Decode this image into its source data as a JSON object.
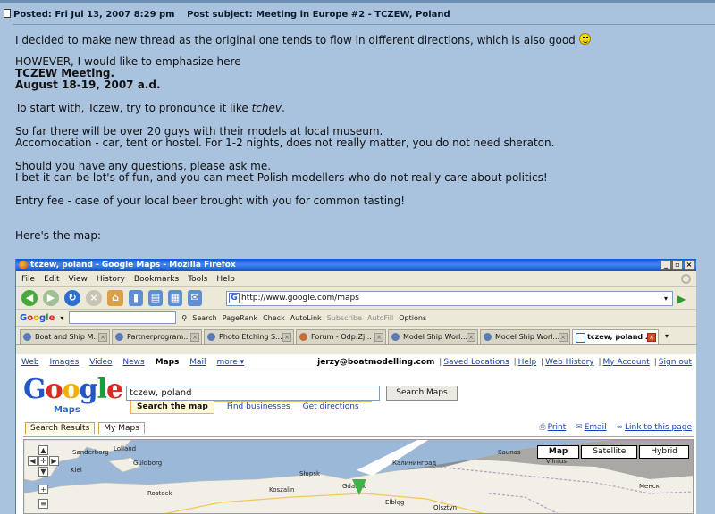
{
  "post": {
    "posted_label": "Posted:",
    "posted_date": "Fri Jul 13, 2007 8:29 pm",
    "subject_label": "Post subject:",
    "subject": "Meeting in Europe #2 - TCZEW, Poland",
    "line1": "I decided to make new thread as the original one tends to flow in different directions, which is also good",
    "line2": "HOWEVER, I would like to emphasize here",
    "line3": "TCZEW Meeting.",
    "line4": "August 18-19, 2007 a.d.",
    "line5a": "To start with, Tczew, try to pronounce it like ",
    "line5b": "tchev",
    "line5c": ".",
    "line6": "So far there will be over 20 guys with their models at local museum.",
    "line7": "Accomodation - car, tent or hostel. For 1-2 nights, does not really matter, you do not need sheraton.",
    "line8": "Should you have any questions, please ask me.",
    "line9": "I bet it can be lot's of fun, and you can meet Polish modellers who do not really care about politics!",
    "line10": "Entry fee - case of your local beer brought with you for common tasting!",
    "line11": "Here's the map:"
  },
  "browser": {
    "title": "tczew, poland - Google Maps - Mozilla Firefox",
    "menu": [
      "File",
      "Edit",
      "View",
      "History",
      "Bookmarks",
      "Tools",
      "Help"
    ],
    "url": "http://www.google.com/maps",
    "toolbar": {
      "logo": "Google",
      "search": "Search",
      "pagerank": "PageRank",
      "check": "Check",
      "autolink": "AutoLink",
      "subscribe": "Subscribe",
      "autofill": "AutoFill",
      "options": "Options"
    },
    "tabs": [
      "Boat and Ship M...",
      "Partnerprogram...",
      "Photo Etching S...",
      "Forum - Odp:Zj...",
      "Model Ship Worl...",
      "Model Ship Worl...",
      "tczew, poland ..."
    ]
  },
  "gmaps": {
    "nav_links": [
      "Web",
      "Images",
      "Video",
      "News",
      "Maps",
      "Mail",
      "more ▾"
    ],
    "account_email": "jerzy@boatmodelling.com",
    "account_links": [
      "Saved Locations",
      "Help",
      "Web History",
      "My Account",
      "Sign out"
    ],
    "logo_sub": "Maps",
    "query": "tczew, poland",
    "search_button": "Search Maps",
    "search_tabs": [
      "Search the map",
      "Find businesses",
      "Get directions"
    ],
    "left_tabs": [
      "Search Results",
      "My Maps"
    ],
    "page_links": [
      "Print",
      "Email",
      "Link to this page"
    ],
    "map_types": [
      "Map",
      "Satellite",
      "Hybrid"
    ],
    "places": [
      "Sønderborg",
      "Kiel",
      "Lolland",
      "Güldborg",
      "Rostock",
      "Słupsk",
      "Koszalin",
      "Калининград",
      "Gdańsk",
      "Elbląg",
      "Olsztyn",
      "Kaunas",
      "Vilnius",
      "Менск"
    ]
  },
  "colors": {
    "forum_bg": "#a9c3df",
    "title_blue": "#0a58d6",
    "link_blue": "#1a3fb4",
    "pin_green": "#3fb24a"
  }
}
